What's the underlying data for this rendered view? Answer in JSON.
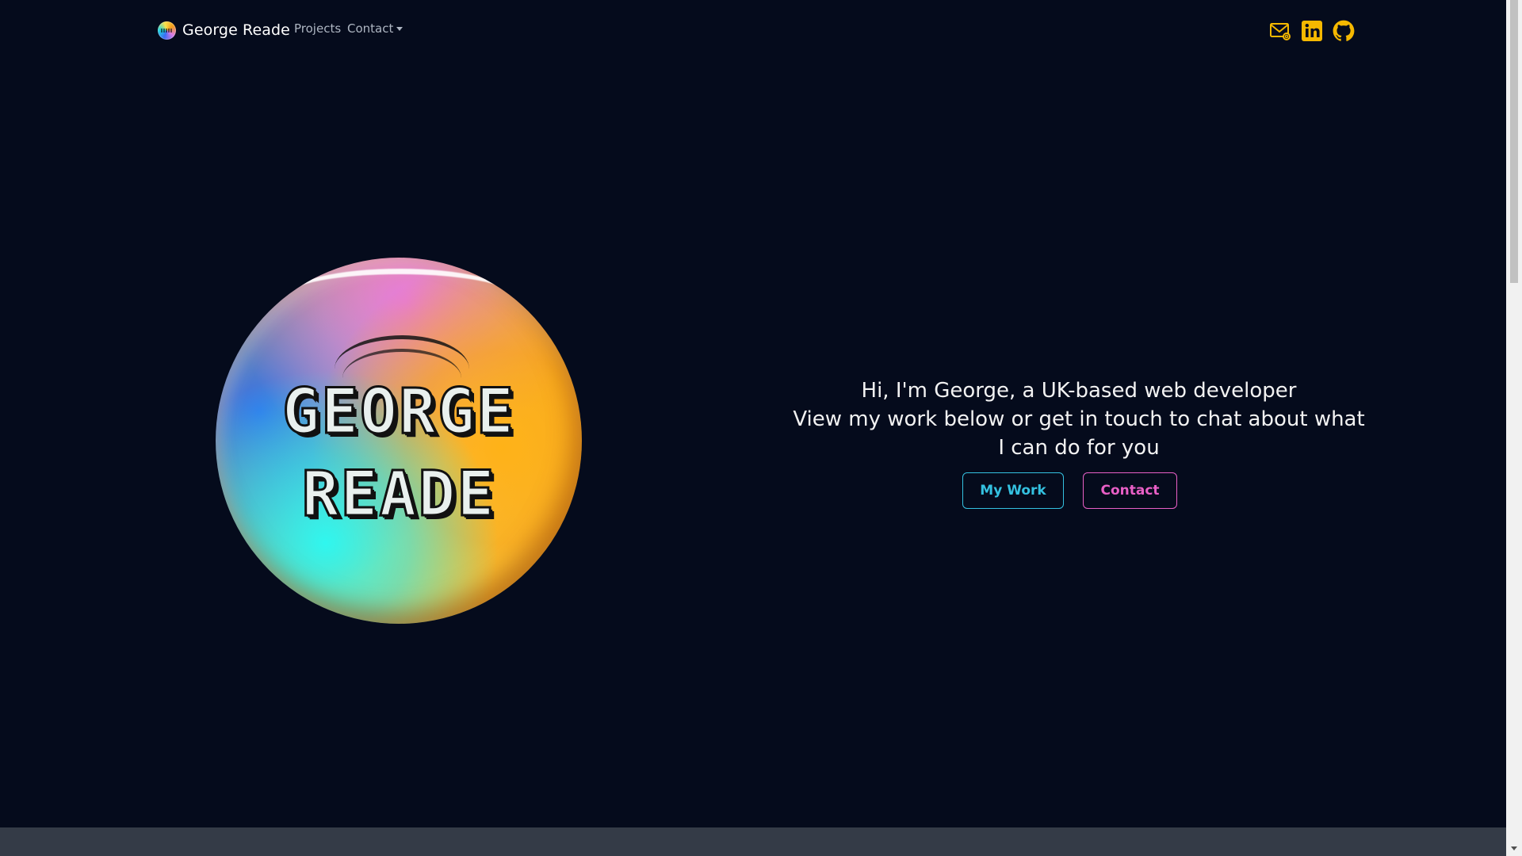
{
  "navbar": {
    "brand_text": "George Reade",
    "links": {
      "projects": "Projects",
      "contact": "Contact"
    },
    "social_icons": [
      "mail-icon",
      "linkedin-icon",
      "github-icon"
    ],
    "icon_color": "#f5b800"
  },
  "hero": {
    "orb_line1": "GEORGE",
    "orb_line2": "READE",
    "lines": [
      "Hi, I'm George, a UK-based web developer",
      "View my work below or get in touch to chat about what",
      "I can do for you"
    ],
    "buttons": {
      "my_work": "My Work",
      "contact": "Contact"
    }
  },
  "colors": {
    "background": "#050b1c",
    "accent_cyan": "#34c1e0",
    "accent_pink": "#e85fc6",
    "footer_band": "#343b47"
  }
}
